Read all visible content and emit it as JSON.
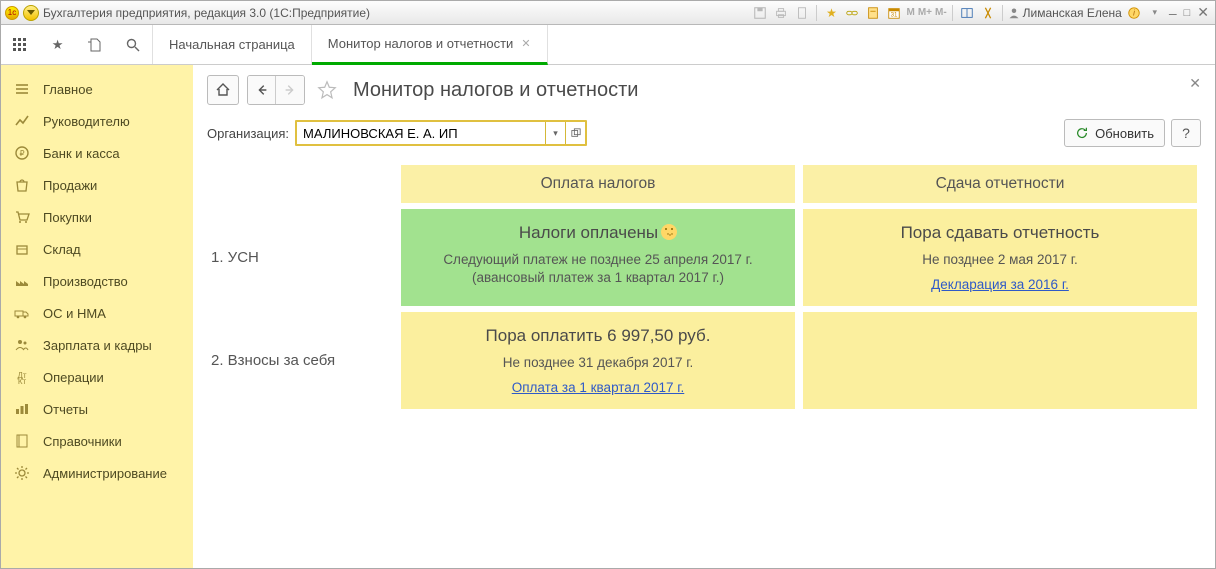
{
  "title_bar": {
    "app_title": "Бухгалтерия предприятия, редакция 3.0  (1С:Предприятие)",
    "user_name": "Лиманская Елена"
  },
  "nav_tabs": {
    "start_page": "Начальная страница",
    "active_tab": "Монитор налогов и отчетности"
  },
  "sidebar": {
    "items": [
      {
        "label": "Главное",
        "icon": "menu"
      },
      {
        "label": "Руководителю",
        "icon": "chart"
      },
      {
        "label": "Банк и касса",
        "icon": "ruble"
      },
      {
        "label": "Продажи",
        "icon": "bag"
      },
      {
        "label": "Покупки",
        "icon": "cart"
      },
      {
        "label": "Склад",
        "icon": "box"
      },
      {
        "label": "Производство",
        "icon": "factory"
      },
      {
        "label": "ОС и НМА",
        "icon": "truck"
      },
      {
        "label": "Зарплата и кадры",
        "icon": "people"
      },
      {
        "label": "Операции",
        "icon": "ops"
      },
      {
        "label": "Отчеты",
        "icon": "bars"
      },
      {
        "label": "Справочники",
        "icon": "book"
      },
      {
        "label": "Администрирование",
        "icon": "gear"
      }
    ]
  },
  "page": {
    "title": "Монитор налогов и отчетности",
    "org_label": "Организация:",
    "org_value": "МАЛИНОВСКАЯ Е. А. ИП",
    "refresh_label": "Обновить",
    "help_label": "?"
  },
  "monitor": {
    "col_pay": "Оплата налогов",
    "col_report": "Сдача отчетности",
    "rows": [
      {
        "num_label": "1. УСН",
        "pay": {
          "style": "green",
          "title": "Налоги оплачены",
          "smiley": true,
          "line1": "Следующий платеж не позднее 25 апреля 2017 г.",
          "line2": "(авансовый платеж за 1 квартал 2017 г.)"
        },
        "report": {
          "style": "yellow",
          "title": "Пора сдавать отчетность",
          "line1": "Не позднее 2 мая 2017 г.",
          "link": "Декларация за 2016 г."
        }
      },
      {
        "num_label": "2. Взносы за себя",
        "pay": {
          "style": "yellow",
          "title": "Пора оплатить 6 997,50 руб.",
          "line1": "Не позднее 31 декабря 2017 г.",
          "link": "Оплата за 1 квартал 2017 г."
        },
        "report": {
          "style": "yellow",
          "title": "",
          "line1": ""
        }
      }
    ]
  }
}
